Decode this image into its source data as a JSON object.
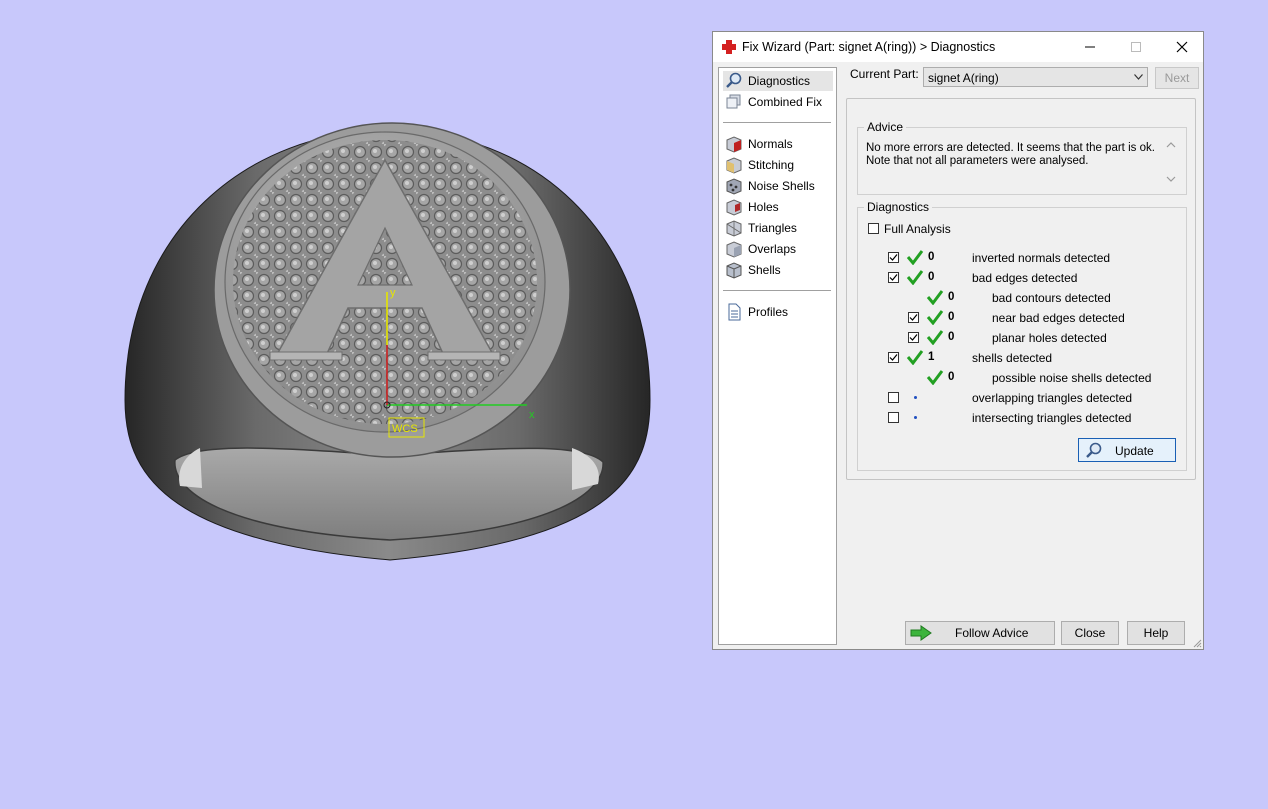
{
  "viewport": {
    "axis_labels": {
      "x": "x",
      "y": "y"
    },
    "wcs_label": "WCS",
    "letter": "A"
  },
  "dialog": {
    "title": "Fix Wizard (Part: signet A(ring)) > Diagnostics",
    "nav": {
      "diagnostics": "Diagnostics",
      "combined_fix": "Combined Fix",
      "normals": "Normals",
      "stitching": "Stitching",
      "noise_shells": "Noise Shells",
      "holes": "Holes",
      "triangles": "Triangles",
      "overlaps": "Overlaps",
      "shells": "Shells",
      "profiles": "Profiles",
      "selected": "Diagnostics"
    },
    "current_part_label": "Current Part:",
    "current_part_value": "signet A(ring)",
    "next_label": "Next",
    "advice": {
      "title": "Advice",
      "line1": "No more errors are detected. It seems that the part is ok.",
      "line2": "Note that not all parameters were analysed."
    },
    "diagnostics": {
      "title": "Diagnostics",
      "full_analysis_label": "Full Analysis",
      "full_analysis_checked": false,
      "rows": {
        "inverted_normals": {
          "checked": true,
          "status": "ok",
          "count": "0",
          "label": "inverted normals detected"
        },
        "bad_edges": {
          "checked": true,
          "status": "ok",
          "count": "0",
          "label": "bad edges detected"
        },
        "bad_contours": {
          "status": "ok",
          "count": "0",
          "label": "bad contours detected"
        },
        "near_bad_edges": {
          "checked": true,
          "status": "ok",
          "count": "0",
          "label": "near bad edges detected"
        },
        "planar_holes": {
          "checked": true,
          "status": "ok",
          "count": "0",
          "label": "planar holes detected"
        },
        "shells": {
          "checked": true,
          "status": "ok",
          "count": "1",
          "label": "shells detected"
        },
        "noise_shells": {
          "status": "ok",
          "count": "0",
          "label": "possible noise shells detected"
        },
        "overlapping": {
          "checked": false,
          "status": "not-analysed",
          "label": "overlapping triangles detected"
        },
        "intersecting": {
          "checked": false,
          "status": "not-analysed",
          "label": "intersecting triangles detected"
        }
      },
      "update_label": "Update"
    },
    "buttons": {
      "follow_advice": "Follow Advice",
      "close": "Close",
      "help": "Help"
    },
    "colors": {
      "background": "#c8c8fb",
      "check_green": "#22a022",
      "title_icon_red": "#d42020"
    }
  }
}
